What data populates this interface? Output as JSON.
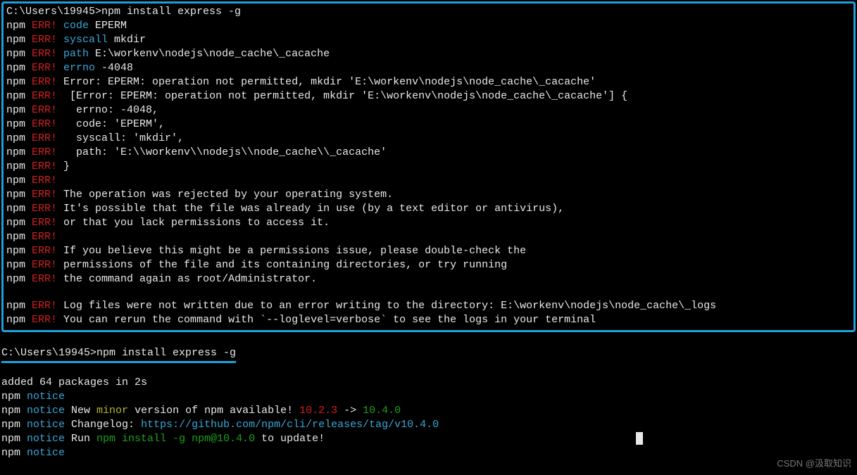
{
  "prompt1_path": "C:\\Users\\19945>",
  "prompt1_cmd": "npm install express -g",
  "err_label_npm": "npm",
  "err_label_err": " ERR!",
  "err_code_key": " code",
  "err_code_val": " EPERM",
  "err_syscall_key": " syscall",
  "err_syscall_val": " mkdir",
  "err_path_key": " path",
  "err_path_val": " E:\\workenv\\nodejs\\node_cache\\_cacache",
  "err_errno_key": " errno",
  "err_errno_val": " -4048",
  "err_l1": " Error: EPERM: operation not permitted, mkdir 'E:\\workenv\\nodejs\\node_cache\\_cacache'",
  "err_l2": "  [Error: EPERM: operation not permitted, mkdir 'E:\\workenv\\nodejs\\node_cache\\_cacache'] {",
  "err_l3": "   errno: -4048,",
  "err_l4": "   code: 'EPERM',",
  "err_l5": "   syscall: 'mkdir',",
  "err_l6": "   path: 'E:\\\\workenv\\\\nodejs\\\\node_cache\\\\_cacache'",
  "err_l7": " }",
  "err_blank": "",
  "err_l8": " The operation was rejected by your operating system.",
  "err_l9": " It's possible that the file was already in use (by a text editor or antivirus),",
  "err_l10": " or that you lack permissions to access it.",
  "err_l11": " If you believe this might be a permissions issue, please double-check the",
  "err_l12": " permissions of the file and its containing directories, or try running",
  "err_l13": " the command again as root/Administrator.",
  "err_l14": " Log files were not written due to an error writing to the directory: E:\\workenv\\nodejs\\node_cache\\_logs",
  "err_l15": " You can rerun the command with `--loglevel=verbose` to see the logs in your terminal",
  "prompt2_path": "C:\\Users\\19945>",
  "prompt2_cmd": "npm install express -g",
  "added_line": "added 64 packages in 2s",
  "notice_npm": "npm",
  "notice_label": " notice",
  "notice2_pre": " New ",
  "notice2_minor": "minor",
  "notice2_mid": " version of npm available! ",
  "notice2_old": "10.2.3",
  "notice2_arrow": " -> ",
  "notice2_new": "10.4.0",
  "notice3_pre": " Changelog: ",
  "notice3_url": "https://github.com/npm/cli/releases/tag/v10.4.0",
  "notice4_pre": " Run ",
  "notice4_cmd": "npm install -g npm@10.4.0",
  "notice4_post": " to update!",
  "watermark": "CSDN @汲取知识"
}
